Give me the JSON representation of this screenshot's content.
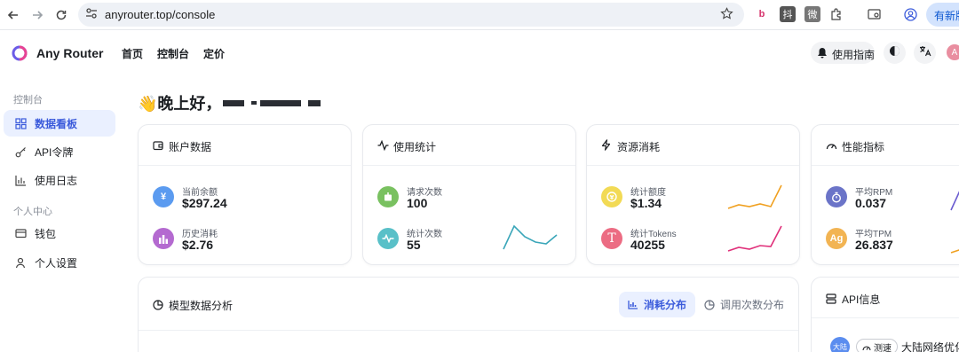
{
  "browser": {
    "url": "anyrouter.top/console",
    "new_tab_label": "有新版"
  },
  "app": {
    "brand": "Any Router",
    "nav": [
      "首页",
      "控制台",
      "定价"
    ],
    "guide_label": "使用指南",
    "avatar_letter": "A"
  },
  "sidebar": {
    "group_console": "控制台",
    "items_console": [
      {
        "label": "数据看板",
        "icon": "grid-icon",
        "active": true
      },
      {
        "label": "API令牌",
        "icon": "key-icon",
        "active": false
      },
      {
        "label": "使用日志",
        "icon": "bar-chart-icon",
        "active": false
      }
    ],
    "group_personal": "个人中心",
    "items_personal": [
      {
        "label": "钱包",
        "icon": "wallet-icon",
        "active": false
      },
      {
        "label": "个人设置",
        "icon": "user-icon",
        "active": false
      }
    ]
  },
  "greeting": {
    "text": "👋晚上好，"
  },
  "cards": {
    "account": {
      "title": "账户数据",
      "balance_label": "当前余额",
      "balance_value": "$297.24",
      "spent_label": "历史消耗",
      "spent_value": "$2.76"
    },
    "usage": {
      "title": "使用统计",
      "requests_label": "请求次数",
      "requests_value": "100",
      "count_label": "统计次数",
      "count_value": "55"
    },
    "resource": {
      "title": "资源消耗",
      "quota_label": "统计额度",
      "quota_value": "$1.34",
      "tokens_label": "统计Tokens",
      "tokens_value": "40255"
    },
    "performance": {
      "title": "性能指标",
      "rpm_label": "平均RPM",
      "rpm_value": "0.037",
      "tpm_label": "平均TPM",
      "tpm_value": "26.837"
    }
  },
  "analysis": {
    "title": "模型数据分析",
    "tab_consumption": "消耗分布",
    "tab_calls": "调用次数分布"
  },
  "api_info": {
    "title": "API信息",
    "badge": "大陆",
    "speed_label": "测速",
    "route_name": "大陆网络优化"
  },
  "colors": {
    "accent": "#3b5bdb",
    "balance_icon": "#5b9bf0",
    "spent_icon": "#b46ad0",
    "requests_icon": "#79c160",
    "count_icon": "#59c0c8",
    "quota_icon": "#f2da55",
    "tokens_icon": "#ec6c83",
    "rpm_icon": "#6b74c8",
    "tpm_icon": "#f2b453"
  }
}
